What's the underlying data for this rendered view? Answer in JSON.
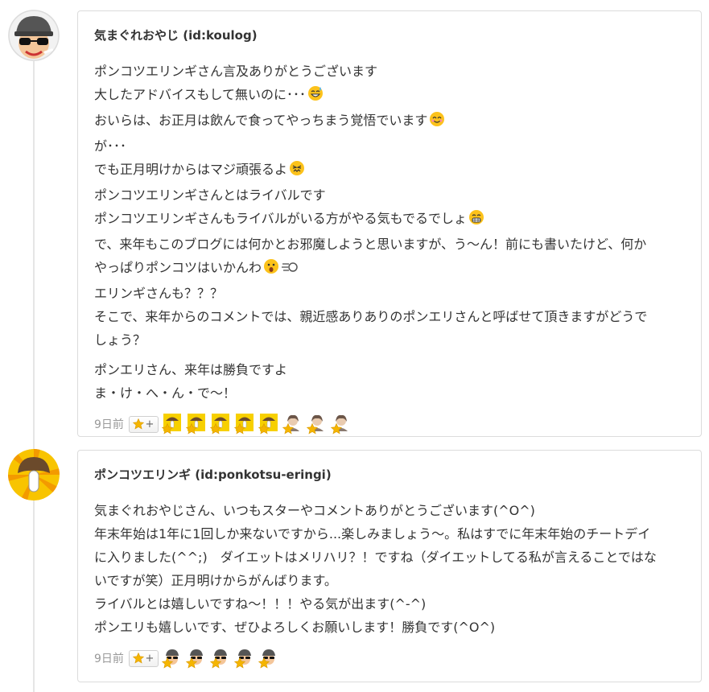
{
  "comments": [
    {
      "author": "気まぐれおやじ (id:koulog)",
      "paragraphs": [
        [
          {
            "text": "ポンコツエリンギさん言及ありがとうございます",
            "emoji": []
          },
          {
            "text": "大したアドバイスもして無いのに･･･",
            "emoji": [
              "sweat-smile-emoji"
            ]
          },
          {
            "text": "おいらは、お正月は飲んで食ってやっちまう覚悟でいます",
            "emoji": [
              "smile-emoji"
            ]
          },
          {
            "text": "が･･･",
            "emoji": []
          },
          {
            "text": "でも正月明けからはマジ頑張るよ",
            "emoji": [
              "persevere-emoji"
            ]
          },
          {
            "text": "ポンコツエリンギさんとはライバルです",
            "emoji": []
          },
          {
            "text": "ポンコツエリンギさんもライバルがいる方がやる気もでるでしょ",
            "emoji": [
              "grin-emoji"
            ]
          },
          {
            "text": "で、来年もこのブログには何かとお邪魔しようと思いますが、う～ん！前にも書いたけど、何か",
            "emoji": []
          },
          {
            "text": "やっぱりポンコツはいかんわ",
            "emoji": [
              "astonished-emoji",
              "dash-emoji"
            ]
          },
          {
            "text": "エリンギさんも？？？",
            "emoji": []
          },
          {
            "text": "そこで、来年からのコメントでは、親近感ありありのポンエリさんと呼ばせて頂きますがどうで",
            "emoji": []
          },
          {
            "text": "しょう？",
            "emoji": []
          }
        ],
        [
          {
            "text": "ポンエリさん、来年は勝負ですよ",
            "emoji": []
          },
          {
            "text": "ま・け・へ・ん・で～！",
            "emoji": []
          }
        ]
      ],
      "time": "9日前",
      "stars": [
        "mushroom",
        "mushroom",
        "mushroom",
        "mushroom",
        "mushroom",
        "user",
        "user",
        "user"
      ]
    },
    {
      "author": "ポンコツエリンギ (id:ponkotsu-eringi)",
      "paragraphs": [
        [
          {
            "text": "気まぐれおやじさん、いつもスターやコメントありがとうございます(^O^)",
            "emoji": []
          },
          {
            "text": "年末年始は1年に1回しか来ないですから...楽しみましょう～。私はすでに年末年始のチートデイ",
            "emoji": []
          },
          {
            "text": "に入りました(^^;)　ダイエットはメリハリ？！ですね（ダイエットしてる私が言えることではな",
            "emoji": []
          },
          {
            "text": "いですが笑）正月明けからがんばります。",
            "emoji": []
          },
          {
            "text": "ライバルとは嬉しいですね～！！！やる気が出ます(^-^)",
            "emoji": []
          },
          {
            "text": "ポンエリも嬉しいです、ぜひよろしくお願いします！勝負です(^O^)",
            "emoji": []
          }
        ]
      ],
      "time": "9日前",
      "stars": [
        "koulog",
        "koulog",
        "koulog",
        "koulog",
        "koulog"
      ]
    }
  ],
  "colors": {
    "star": "#f5b500",
    "border": "#dcdcdc",
    "text": "#333333",
    "muted": "#999999"
  }
}
